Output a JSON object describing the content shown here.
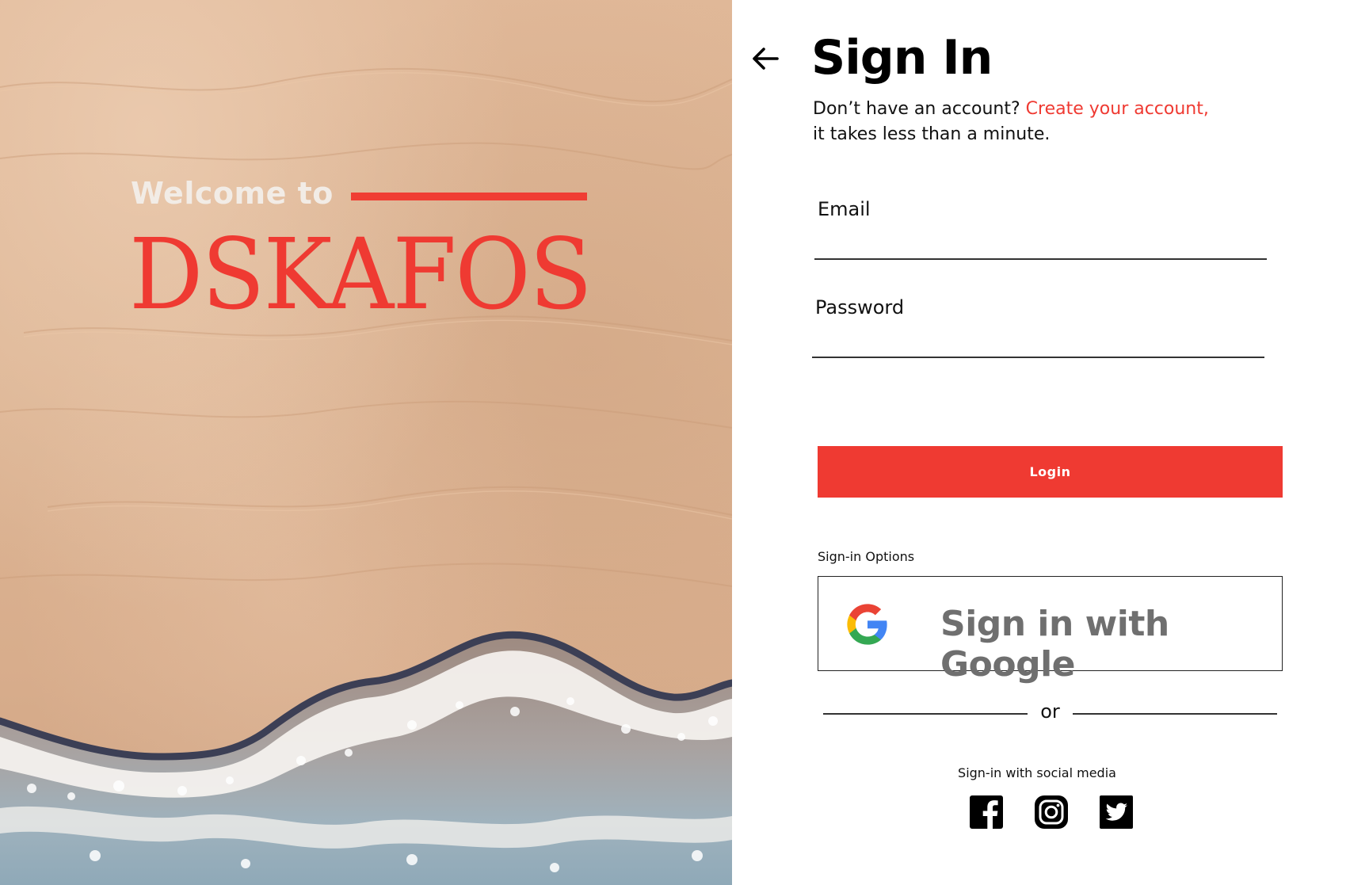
{
  "hero": {
    "welcome": "Welcome to",
    "brand": "DSKAFOS",
    "accent_color": "#ef3a32"
  },
  "signin": {
    "back_icon": "arrow-left-icon",
    "title": "Sign In",
    "prompt": "Don’t have an account?",
    "create_link": "Create your account,",
    "prompt_tail": "it takes less than a minute.",
    "email_label": "Email",
    "email_value": "",
    "password_label": "Password",
    "password_value": "",
    "login_label": "Login",
    "options_label": "Sign-in Options",
    "google_label": "Sign in with Google",
    "google_icon": "google-g-icon",
    "or_label": "or",
    "social_label": "Sign-in with social media",
    "social": [
      {
        "name": "facebook-icon"
      },
      {
        "name": "instagram-icon"
      },
      {
        "name": "twitter-icon"
      }
    ]
  }
}
